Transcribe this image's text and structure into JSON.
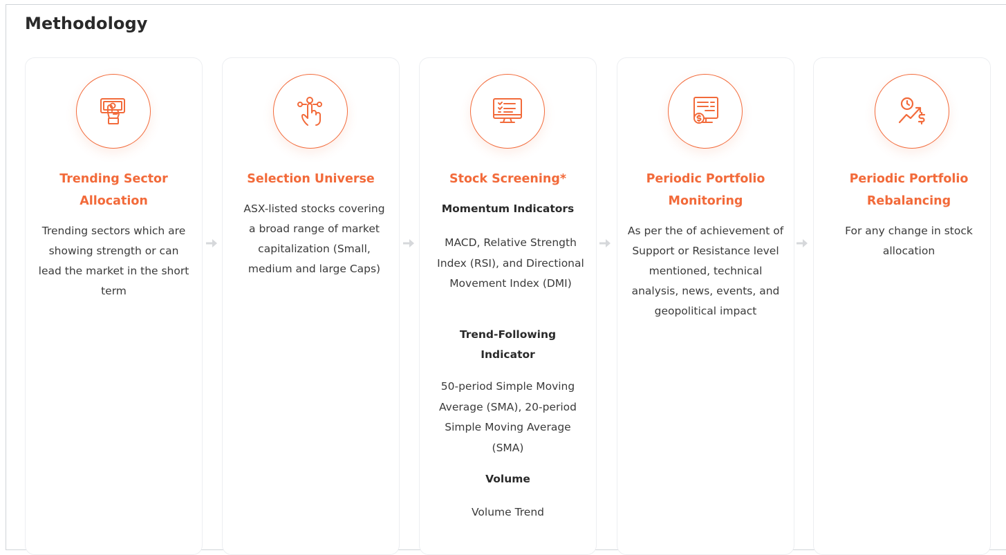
{
  "page": {
    "title": "Methodology"
  },
  "accent_color": "#f26a3a",
  "cards": [
    {
      "icon": "banknote-hand-icon",
      "title": "Trending Sector Allocation",
      "description": "Trending sectors which are showing strength or can lead the market in the short term"
    },
    {
      "icon": "hand-tap-icon",
      "title": "Selection Universe",
      "description": "ASX-listed stocks covering a broad range of market capitalization (Small, medium and large Caps)"
    },
    {
      "icon": "monitor-checklist-icon",
      "title": "Stock Screening*",
      "sections": [
        {
          "heading": "Momentum Indicators",
          "text": "MACD, Relative Strength Index (RSI), and Directional Movement Index (DMI)"
        },
        {
          "heading": "Trend-Following Indicator",
          "text": "50-period Simple Moving Average (SMA), 20-period Simple Moving Average (SMA)"
        },
        {
          "heading": "Volume",
          "text": "Volume Trend"
        }
      ]
    },
    {
      "icon": "monitor-dollar-icon",
      "title": "Periodic Portfolio Monitoring",
      "description": "As per the of achievement of Support or Resistance level mentioned, technical analysis, news, events, and geopolitical impact"
    },
    {
      "icon": "rebalance-trend-dollar-icon",
      "title": "Periodic Portfolio Rebalancing",
      "description": "For any change in stock allocation"
    }
  ]
}
